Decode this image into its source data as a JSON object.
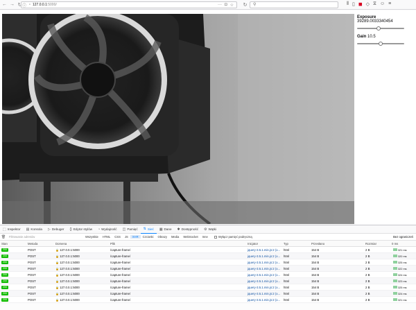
{
  "browser": {
    "url_host": "127.0.0.1",
    "url_port": ":5000/"
  },
  "camera": {
    "exposure_label": "Exposure",
    "exposure_value": "39289.0033340454",
    "exposure_level": 0.45,
    "gain_label": "Gain",
    "gain_value": "10.5",
    "gain_level": 0.5
  },
  "devtools": {
    "tabs": [
      "Inspektor",
      "Konsola",
      "Debuger",
      "Edytor stylów",
      "Wydajność",
      "Pamięć",
      "Sieć",
      "Dane",
      "Dostępność",
      "Wątki"
    ],
    "active_tab": "Sieć",
    "filter_placeholder": "Filtrowanie adresów",
    "filter_buttons": [
      "Wszystkie",
      "HTML",
      "CSS",
      "JS",
      "XHR",
      "Czcionki",
      "Obrazy",
      "Media",
      "WebSocket",
      "Inne"
    ],
    "active_filter": "XHR",
    "disable_cache_label": "Wyłącz pamięć podręczną",
    "throttle_label": "Bez ograniczeń",
    "columns": [
      "Stan",
      "Metoda",
      "Domena",
      "Plik",
      "Inicjator",
      "Typ",
      "Przesłano",
      "Rozmiar",
      "0 ms"
    ],
    "rows": [
      {
        "status": "200",
        "method": "POST",
        "domain": "127.0.0.1:5000",
        "file": "/capture-frame/",
        "cause": "jquery-3.5.1.min.js:2 (x...",
        "type": "html",
        "transferred": "154 B",
        "size": "2 B",
        "time": "321 ms"
      },
      {
        "status": "200",
        "method": "POST",
        "domain": "127.0.0.1:5000",
        "file": "/capture-frame/",
        "cause": "jquery-3.5.1.min.js:2 (x...",
        "type": "html",
        "transferred": "154 B",
        "size": "2 B",
        "time": "320 ms"
      },
      {
        "status": "200",
        "method": "POST",
        "domain": "127.0.0.1:5000",
        "file": "/capture-frame/",
        "cause": "jquery-3.5.1.min.js:2 (x...",
        "type": "html",
        "transferred": "154 B",
        "size": "2 B",
        "time": "325 ms"
      },
      {
        "status": "200",
        "method": "POST",
        "domain": "127.0.0.1:5000",
        "file": "/capture-frame/",
        "cause": "jquery-3.5.1.min.js:2 (x...",
        "type": "html",
        "transferred": "154 B",
        "size": "2 B",
        "time": "322 ms"
      },
      {
        "status": "200",
        "method": "POST",
        "domain": "127.0.0.1:5000",
        "file": "/capture-frame/",
        "cause": "jquery-3.5.1.min.js:2 (x...",
        "type": "html",
        "transferred": "154 B",
        "size": "2 B",
        "time": "324 ms"
      },
      {
        "status": "200",
        "method": "POST",
        "domain": "127.0.0.1:5000",
        "file": "/capture-frame/",
        "cause": "jquery-3.5.1.min.js:2 (x...",
        "type": "html",
        "transferred": "154 B",
        "size": "2 B",
        "time": "323 ms"
      },
      {
        "status": "200",
        "method": "POST",
        "domain": "127.0.0.1:5000",
        "file": "/capture-frame/",
        "cause": "jquery-3.5.1.min.js:2 (x...",
        "type": "html",
        "transferred": "154 B",
        "size": "2 B",
        "time": "325 ms"
      },
      {
        "status": "200",
        "method": "POST",
        "domain": "127.0.0.1:5000",
        "file": "/capture-frame/",
        "cause": "jquery-3.5.1.min.js:2 (x...",
        "type": "html",
        "transferred": "154 B",
        "size": "2 B",
        "time": "324 ms"
      },
      {
        "status": "200",
        "method": "POST",
        "domain": "127.0.0.1:5000",
        "file": "/capture-frame/",
        "cause": "jquery-3.5.1.min.js:2 (x...",
        "type": "html",
        "transferred": "154 B",
        "size": "2 B",
        "time": "321 ms"
      }
    ]
  }
}
